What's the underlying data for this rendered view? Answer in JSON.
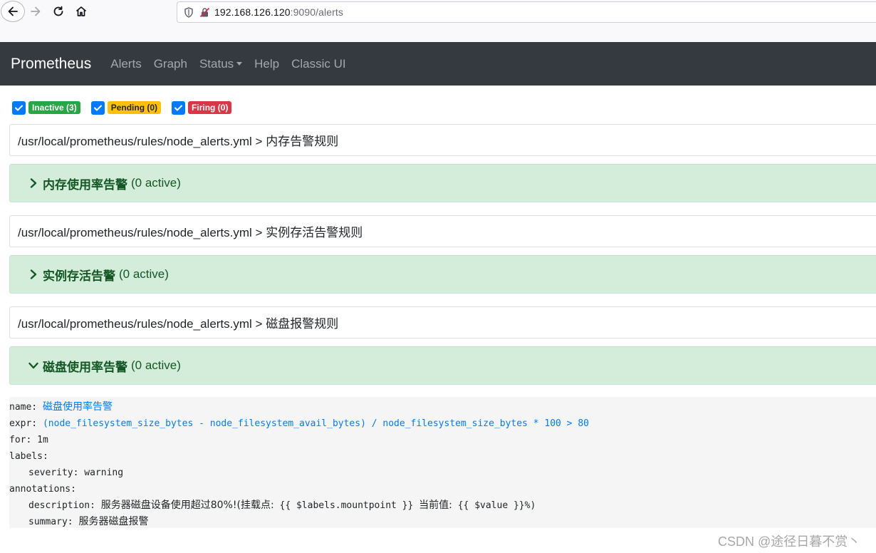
{
  "browser": {
    "url_host": "192.168.126.120",
    "url_rest": ":9090/alerts"
  },
  "navbar": {
    "brand": "Prometheus",
    "links": [
      "Alerts",
      "Graph",
      "Status",
      "Help",
      "Classic UI"
    ]
  },
  "filters": [
    {
      "label": "Inactive (3)",
      "checked": true,
      "color": "#28a745"
    },
    {
      "label": "Pending (0)",
      "checked": true,
      "color": "#ffc107"
    },
    {
      "label": "Firing (0)",
      "checked": true,
      "color": "#dc3545"
    }
  ],
  "groups": [
    {
      "header": "/usr/local/prometheus/rules/node_alerts.yml > 内存告警规则",
      "rule_name": "内存使用率告警",
      "rule_active": "(0 active)",
      "expanded": false
    },
    {
      "header": "/usr/local/prometheus/rules/node_alerts.yml > 实例存活告警规则",
      "rule_name": "实例存活告警",
      "rule_active": "(0 active)",
      "expanded": false
    },
    {
      "header": "/usr/local/prometheus/rules/node_alerts.yml > 磁盘报警规则",
      "rule_name": "磁盘使用率告警",
      "rule_active": "(0 active)",
      "expanded": true
    }
  ],
  "rule_detail": {
    "name_key": "name:",
    "name_value": "磁盘使用率告警",
    "expr_key": "expr:",
    "expr_value": "(node_filesystem_size_bytes - node_filesystem_avail_bytes) / node_filesystem_size_bytes * 100 > 80",
    "for_line": "for: 1m",
    "labels_key": "labels:",
    "severity_line": "severity: warning",
    "annotations_key": "annotations:",
    "description_key": "description:",
    "description_a": "服务器磁盘设备使用超过80%!(挂载点:",
    "description_b": "{{ $labels.mountpoint }}",
    "description_c": "当前值:",
    "description_d": "{{ $value }}%)",
    "summary_key": "summary:",
    "summary_value": "服务器磁盘报警"
  },
  "watermark": "CSDN @途径日暮不赏丶",
  "colors": {
    "navbar_bg": "#343a40",
    "rule_bg": "#d4edda",
    "rule_text": "#155724",
    "link_blue": "#007bff"
  }
}
